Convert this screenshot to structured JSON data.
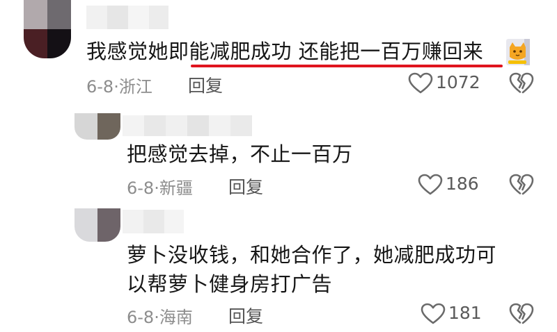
{
  "colors": {
    "accent_underline": "#e0141e",
    "meta_text": "#8d8d8d",
    "icon_stroke": "#6a6a6a"
  },
  "comments": [
    {
      "text": "我感觉她即能减肥成功 还能把一百万赚回来",
      "date_location": "6-8·浙江",
      "reply_label": "回复",
      "likes": "1072",
      "has_underline": true,
      "sticker_icon": "cat-emoji-icon"
    },
    {
      "text": "把感觉去掉，不止一百万",
      "date_location": "6-8·新疆",
      "reply_label": "回复",
      "likes": "186"
    },
    {
      "text_line1": "萝卜没收钱，和她合作了，她减肥成功可",
      "text_line2": "以帮萝卜健身房打广告",
      "date_location": "6-8·海南",
      "reply_label": "回复",
      "likes": "181"
    }
  ]
}
